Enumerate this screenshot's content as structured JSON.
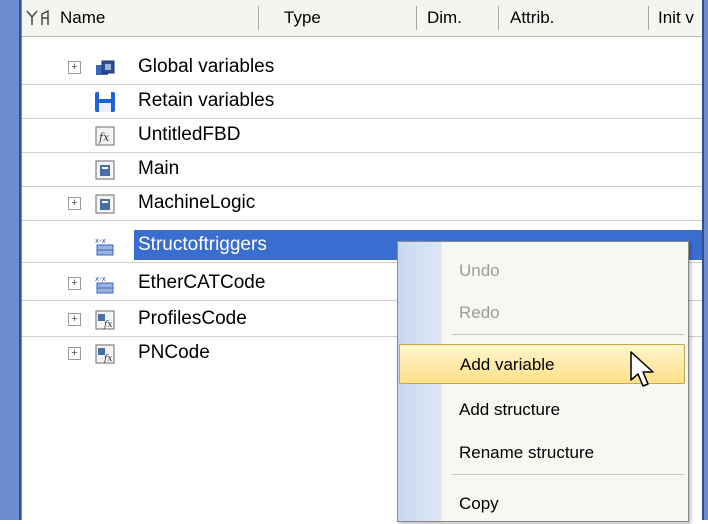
{
  "columns": {
    "name": "Name",
    "type": "Type",
    "dim": "Dim.",
    "attrib": "Attrib.",
    "init": "Init v"
  },
  "tree": {
    "items": [
      {
        "label": "Global variables",
        "icon": "global-variables-icon",
        "expandable": true
      },
      {
        "label": "Retain variables",
        "icon": "retain-variables-icon",
        "expandable": false
      },
      {
        "label": "UntitledFBD",
        "icon": "function-block-icon",
        "expandable": false
      },
      {
        "label": "Main",
        "icon": "program-icon",
        "expandable": false
      },
      {
        "label": "MachineLogic",
        "icon": "program-icon",
        "expandable": true
      },
      {
        "label": "Structoftriggers",
        "icon": "structure-icon",
        "expandable": false,
        "selected": true
      },
      {
        "label": "EtherCATCode",
        "icon": "structure-icon",
        "expandable": true
      },
      {
        "label": "ProfilesCode",
        "icon": "profile-code-icon",
        "expandable": true
      },
      {
        "label": "PNCode",
        "icon": "profile-code-icon",
        "expandable": true
      }
    ]
  },
  "context_menu": {
    "items": [
      {
        "label": "Undo",
        "enabled": false
      },
      {
        "label": "Redo",
        "enabled": false
      },
      {
        "label": "Add variable",
        "enabled": true,
        "highlighted": true
      },
      {
        "label": "Add structure",
        "enabled": true
      },
      {
        "label": "Rename structure",
        "enabled": true
      },
      {
        "label": "Copy",
        "enabled": true
      }
    ]
  },
  "colors": {
    "selection": "#3a6dd0",
    "frame": "#6b8ccf",
    "menu_hover": "#ffe08a"
  }
}
